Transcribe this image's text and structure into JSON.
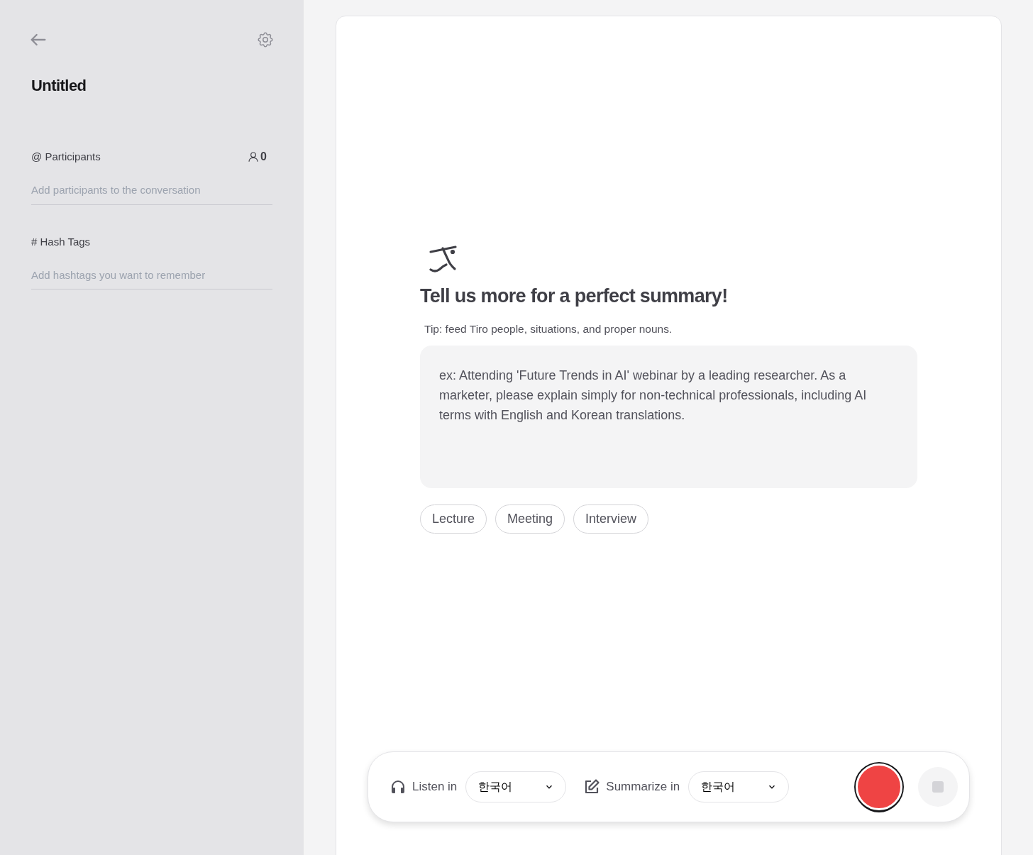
{
  "sidebar": {
    "title": "Untitled",
    "participants": {
      "label": "@ Participants",
      "count": "0",
      "placeholder": "Add participants to the conversation"
    },
    "hashtags": {
      "label": "# Hash Tags",
      "placeholder": "Add hashtags you want to remember"
    }
  },
  "main": {
    "heading": "Tell us more for a perfect summary!",
    "tip": "Tip: feed Tiro people, situations, and proper nouns.",
    "context": {
      "placeholder": "ex: Attending 'Future Trends in AI' webinar by a leading researcher. As a marketer, please explain simply for non-technical professionals, including AI terms with English and Korean translations."
    },
    "presets": [
      {
        "label": "Lecture",
        "selected": false
      },
      {
        "label": "Meeting",
        "selected": false
      },
      {
        "label": "Interview",
        "selected": false
      }
    ]
  },
  "toolbar": {
    "listen": {
      "label": "Listen in",
      "value": "한국어"
    },
    "summarize": {
      "label": "Summarize in",
      "value": "한국어"
    },
    "stop_disabled": true
  }
}
